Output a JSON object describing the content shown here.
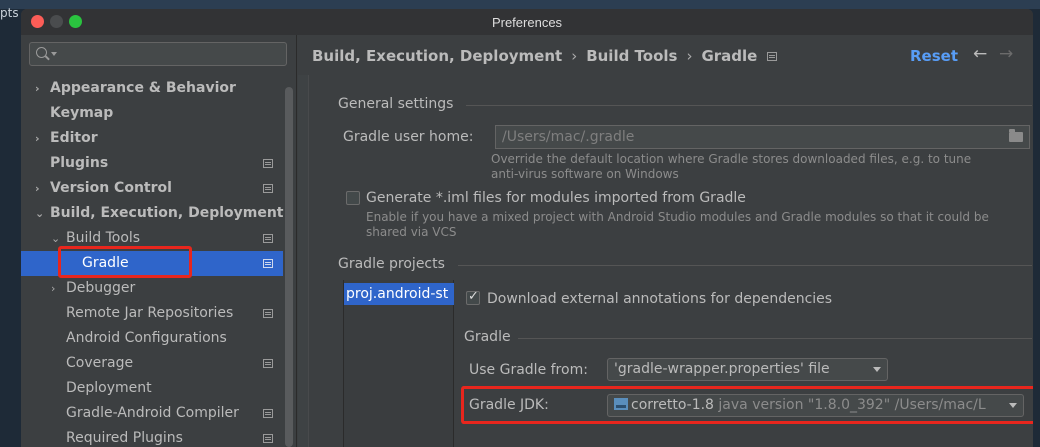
{
  "background": {
    "left_text": "pts"
  },
  "window": {
    "title": "Preferences",
    "colors": {
      "selection": "#2f65ca",
      "link": "#589df6",
      "highlight": "#e8261d",
      "close": "#fc5d57",
      "maximize": "#2ac33f"
    }
  },
  "sidebar": {
    "search": {
      "placeholder": "",
      "icon": "search-icon"
    },
    "items": [
      {
        "label": "Appearance & Behavior",
        "level": 0,
        "arrow": "›",
        "bold": true,
        "project_icon": false
      },
      {
        "label": "Keymap",
        "level": 0,
        "arrow": "",
        "bold": true,
        "project_icon": false
      },
      {
        "label": "Editor",
        "level": 0,
        "arrow": "›",
        "bold": true,
        "project_icon": false
      },
      {
        "label": "Plugins",
        "level": 0,
        "arrow": "",
        "bold": true,
        "project_icon": true
      },
      {
        "label": "Version Control",
        "level": 0,
        "arrow": "›",
        "bold": true,
        "project_icon": true
      },
      {
        "label": "Build, Execution, Deployment",
        "level": 0,
        "arrow": "⌄",
        "bold": true,
        "project_icon": false
      },
      {
        "label": "Build Tools",
        "level": 1,
        "arrow": "⌄",
        "bold": false,
        "project_icon": true
      },
      {
        "label": "Gradle",
        "level": 2,
        "arrow": "",
        "bold": false,
        "project_icon": true,
        "selected": true
      },
      {
        "label": "Debugger",
        "level": 1,
        "arrow": "›",
        "bold": false,
        "project_icon": false
      },
      {
        "label": "Remote Jar Repositories",
        "level": 1,
        "arrow": "",
        "bold": false,
        "project_icon": true
      },
      {
        "label": "Android Configurations",
        "level": 1,
        "arrow": "",
        "bold": false,
        "project_icon": false
      },
      {
        "label": "Coverage",
        "level": 1,
        "arrow": "",
        "bold": false,
        "project_icon": true
      },
      {
        "label": "Deployment",
        "level": 1,
        "arrow": "",
        "bold": false,
        "project_icon": false
      },
      {
        "label": "Gradle-Android Compiler",
        "level": 1,
        "arrow": "",
        "bold": false,
        "project_icon": true
      },
      {
        "label": "Required Plugins",
        "level": 1,
        "arrow": "",
        "bold": false,
        "project_icon": true
      }
    ]
  },
  "header": {
    "breadcrumb": [
      "Build, Execution, Deployment",
      "Build Tools",
      "Gradle"
    ],
    "separator": "›",
    "reset_label": "Reset",
    "back_icon": "←",
    "forward_icon": "→"
  },
  "general": {
    "title": "General settings",
    "user_home_label": "Gradle user home:",
    "user_home_value": "/Users/mac/.gradle",
    "user_home_hint_1": "Override the default location where Gradle stores downloaded files, e.g. to tune",
    "user_home_hint_2": "anti-virus software on Windows",
    "iml_label": "Generate *.iml files for modules imported from Gradle",
    "iml_checked": false,
    "iml_hint_1": "Enable if you have a mixed project with Android Studio modules and Gradle modules so that it could be",
    "iml_hint_2": "shared via VCS"
  },
  "projects": {
    "title": "Gradle projects",
    "list": [
      "proj.android-studio"
    ],
    "list_selected": "proj.android-st",
    "download_annotations_label": "Download external annotations for dependencies",
    "download_annotations_checked": true,
    "gradle_title": "Gradle",
    "use_gradle_from_label": "Use Gradle from:",
    "use_gradle_from_value": "'gradle-wrapper.properties' file",
    "jdk_label": "Gradle JDK:",
    "jdk_name": "corretto-1.8",
    "jdk_detail": "java version \"1.8.0_392\" /Users/mac/L"
  }
}
